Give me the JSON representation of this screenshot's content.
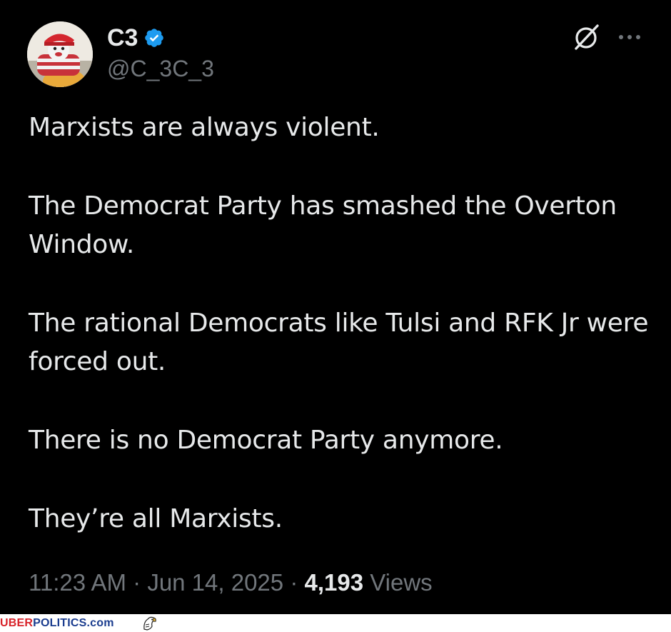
{
  "tweet": {
    "author": {
      "display_name": "C3",
      "handle": "@C_3C_3",
      "verified": true
    },
    "icons": {
      "verified": "verified-badge-icon",
      "grok": "grok-icon",
      "more": "more-options-icon"
    },
    "paragraphs": [
      "Marxists are always violent.",
      "The Democrat Party has smashed the Overton Window.",
      "The rational Democrats like Tulsi and RFK Jr were forced out.",
      "There is no Democrat Party anymore.",
      "They’re all Marxists."
    ],
    "meta": {
      "time": "11:23 AM",
      "separator": " · ",
      "date": "Jun 14, 2025",
      "views_count": "4,193",
      "views_label": " Views"
    }
  },
  "watermark": {
    "part1": "UBER",
    "part2": "POLITICS",
    "part3": ".com"
  },
  "colors": {
    "background": "#000000",
    "text": "#e7e9ea",
    "secondary_text": "#71767b",
    "verified_blue": "#1d9bf0",
    "watermark_red": "#d8232a",
    "watermark_blue": "#1b3d8f"
  }
}
